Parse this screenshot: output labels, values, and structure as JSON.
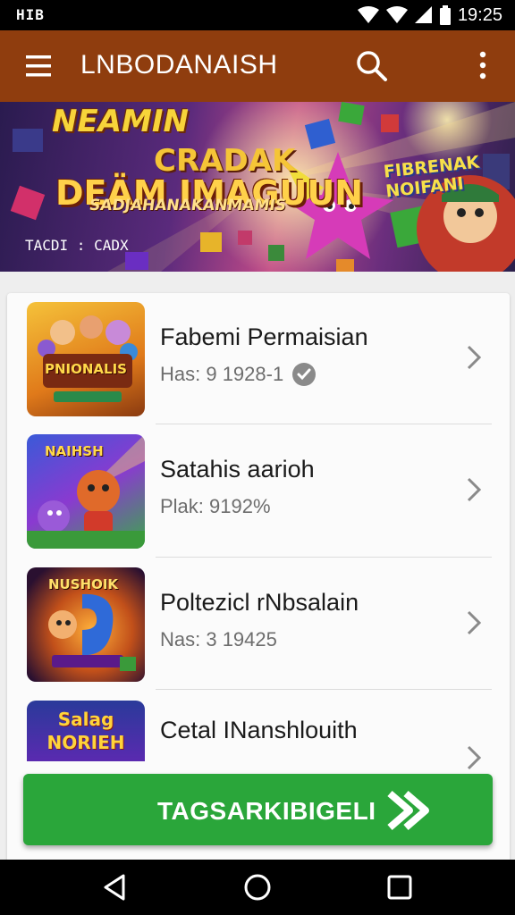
{
  "status_bar": {
    "left_text": "HIB",
    "time": "19:25",
    "icons": [
      "wifi-icon",
      "signal-icon",
      "signal-icon",
      "battery-icon"
    ]
  },
  "app_bar": {
    "title": "LNBODANAISH",
    "icons": [
      "menu-icon",
      "search-icon",
      "more-vert-icon"
    ]
  },
  "banner": {
    "headline": "NEAMIN",
    "title_line_1": "CRADAK",
    "title_line_2": "DEÄM IMAGUUN",
    "tagline": "SADJAHANAKANMAMIS",
    "side_text_1": "FIBRENAK",
    "side_text_2": "NOIFANI",
    "caption": "TACDI : CADX"
  },
  "games": [
    {
      "name": "Fabemi Permaisian",
      "meta": "Has: 9 1928-1",
      "verified": true,
      "thumb_text": "PNIONALIS"
    },
    {
      "name": "Satahis aarioh",
      "meta": "Plak: 9192%",
      "verified": false,
      "thumb_text": "NAIHSH"
    },
    {
      "name": "Poltezicl rNbsalain",
      "meta": "Nas: 3 19425",
      "verified": false,
      "thumb_text": "NUSHOIK"
    },
    {
      "name": "Cetal INanshlouith",
      "meta": "",
      "verified": false,
      "thumb_text": "Salag NORIEH"
    }
  ],
  "cta": {
    "label": "TAGSARKIBIGELI",
    "icon": "double-chevron-right-icon"
  },
  "nav_bar": {
    "icons": [
      "back-icon",
      "home-icon",
      "recents-icon"
    ]
  },
  "colors": {
    "app_bar": "#8f3d0e",
    "cta": "#2aa63a",
    "status_bar": "#000000",
    "card": "#fbfbfb"
  }
}
